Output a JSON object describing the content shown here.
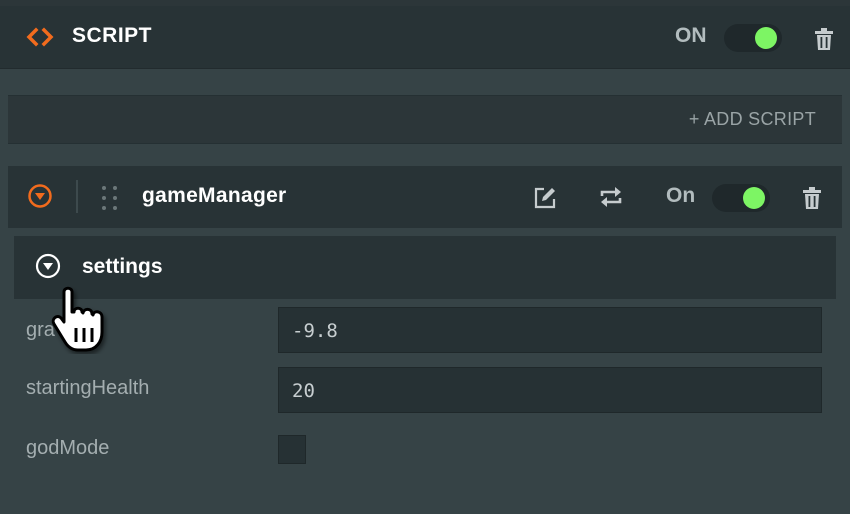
{
  "header": {
    "title": "SCRIPT",
    "state_label": "ON",
    "enabled": true
  },
  "add_script": {
    "label": "+ ADD SCRIPT"
  },
  "script_card": {
    "name": "gameManager",
    "state_label": "On",
    "enabled": true
  },
  "settings": {
    "label": "settings",
    "fields": [
      {
        "label": "gravity",
        "value": "-9.8",
        "visible_label": "gra"
      },
      {
        "label": "startingHealth",
        "value": "20"
      },
      {
        "label": "godMode",
        "checked": false
      }
    ]
  },
  "colors": {
    "accent": "#f26b1d",
    "toggle_on": "#7df564",
    "background": "#364346",
    "panel": "#283336"
  },
  "icons": [
    "code-brackets-icon",
    "trash-icon",
    "collapse-circle-icon",
    "drag-handle-icon",
    "edit-icon",
    "reload-icon",
    "chevron-circle-icon",
    "hand-cursor-icon"
  ]
}
